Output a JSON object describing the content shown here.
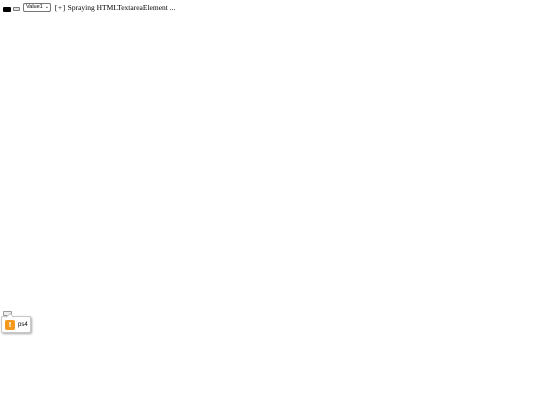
{
  "toolbar": {
    "select_value": "Value1",
    "select_chevron": "⌄",
    "bracket_label": "[+]",
    "status_text": "Spraying HTMLTextareaElement ..."
  },
  "popup": {
    "icon": "warning-icon",
    "icon_glyph": "!",
    "icon_color": "#f39a1e",
    "text": "ps4"
  }
}
